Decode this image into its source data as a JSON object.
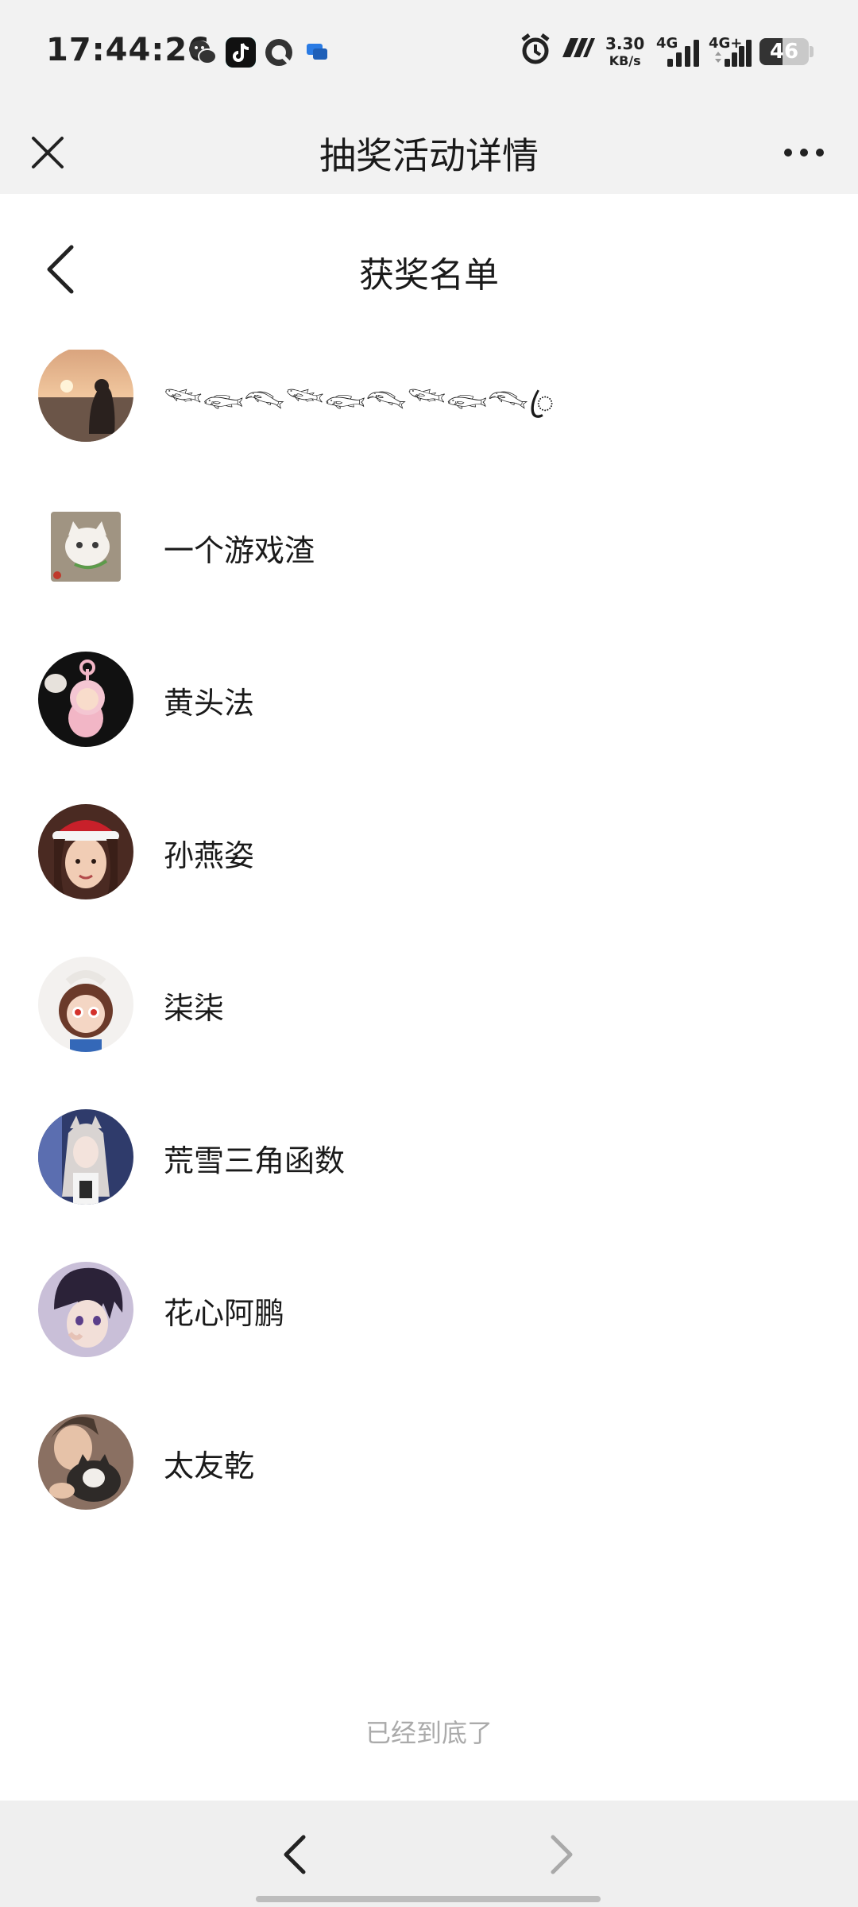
{
  "status_bar": {
    "time": "17:44:26",
    "app_icons": [
      "wechat-icon",
      "tiktok-icon",
      "q-app-icon",
      "message-app-icon"
    ],
    "alarm_icon": "alarm-icon",
    "network_speed_value": "3.30",
    "network_speed_unit": "KB/s",
    "signal_1_label": "4G",
    "signal_2_label": "4G+",
    "battery_level": "46"
  },
  "app_header": {
    "title": "抽奖活动详情",
    "close_icon": "close-icon",
    "more_icon": "more-icon"
  },
  "page_header": {
    "title": "获奖名单",
    "back_icon": "back-icon"
  },
  "winners": [
    {
      "name": "",
      "avatar": "avatar-lilac"
    },
    {
      "name": "𓆝𓆟𓆞𓆝𓆟𓆞𓆝𓆟𓆞ꦿ",
      "avatar": "avatar-sunset"
    },
    {
      "name": "一个游戏渣",
      "avatar": "avatar-cat"
    },
    {
      "name": "黄头法",
      "avatar": "avatar-teletubby"
    },
    {
      "name": "孙燕姿",
      "avatar": "avatar-santa-girl"
    },
    {
      "name": "柒柒",
      "avatar": "avatar-cartoon"
    },
    {
      "name": "荒雪三角函数",
      "avatar": "avatar-anime-girl"
    },
    {
      "name": "花心阿鹏",
      "avatar": "avatar-anime-boy"
    },
    {
      "name": "太友乾",
      "avatar": "avatar-person-cat"
    }
  ],
  "list_end_text": "已经到底了",
  "bottom_nav": {
    "back_icon": "nav-back-icon",
    "forward_icon": "nav-forward-icon"
  }
}
